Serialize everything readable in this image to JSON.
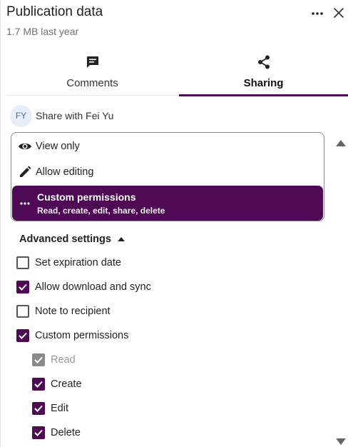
{
  "header": {
    "title": "Publication data",
    "subtitle": "1.7 MB last year",
    "more_icon": "more-horizontal-icon",
    "close_icon": "close-icon"
  },
  "tabs": [
    {
      "label": "Comments",
      "icon": "comment-icon",
      "active": false
    },
    {
      "label": "Sharing",
      "icon": "share-icon",
      "active": true
    }
  ],
  "share": {
    "avatar_initials": "FY",
    "label": "Share with Fei Yu"
  },
  "permissions": {
    "options": [
      {
        "label": "View only",
        "icon": "eye-icon"
      },
      {
        "label": "Allow editing",
        "icon": "pencil-icon"
      },
      {
        "label": "Custom permissions",
        "sublabel": "Read, create, edit, share, delete",
        "icon": "more-horizontal-icon",
        "selected": true
      }
    ]
  },
  "advanced": {
    "label": "Advanced settings",
    "expanded": true,
    "items": [
      {
        "label": "Set expiration date",
        "checked": false
      },
      {
        "label": "Allow download and sync",
        "checked": true
      },
      {
        "label": "Note to recipient",
        "checked": false
      },
      {
        "label": "Custom permissions",
        "checked": true
      },
      {
        "label": "Read",
        "checked": true,
        "disabled": true
      },
      {
        "label": "Create",
        "checked": true
      },
      {
        "label": "Edit",
        "checked": true
      },
      {
        "label": "Delete",
        "checked": true
      }
    ]
  },
  "colors": {
    "accent": "#4f0a55",
    "disabled": "#8a8a8a"
  }
}
